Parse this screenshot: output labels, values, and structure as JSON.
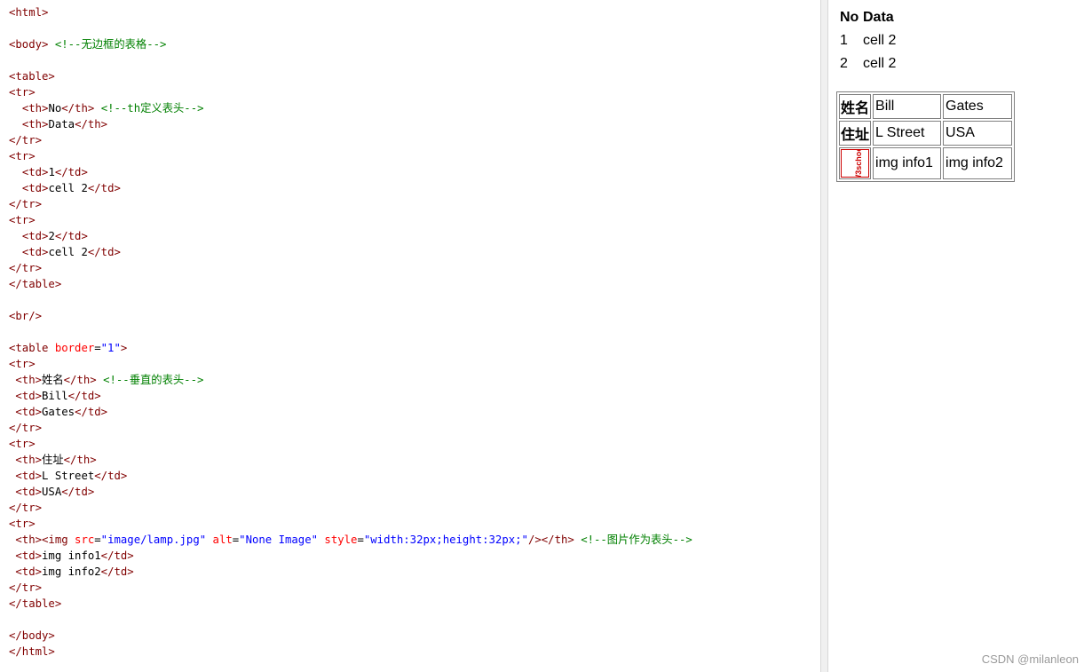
{
  "code_lines": [
    [
      {
        "c": "tag",
        "t": "<html>"
      }
    ],
    [],
    [
      {
        "c": "tag",
        "t": "<body>"
      },
      {
        "c": "txt",
        "t": " "
      },
      {
        "c": "cmt",
        "t": "<!--无边框的表格-->"
      }
    ],
    [],
    [
      {
        "c": "tag",
        "t": "<table>"
      }
    ],
    [
      {
        "c": "tag",
        "t": "<tr>"
      }
    ],
    [
      {
        "c": "txt",
        "t": "  "
      },
      {
        "c": "tag",
        "t": "<th>"
      },
      {
        "c": "txt",
        "t": "No"
      },
      {
        "c": "tag",
        "t": "</th>"
      },
      {
        "c": "txt",
        "t": " "
      },
      {
        "c": "cmt",
        "t": "<!--th定义表头-->"
      }
    ],
    [
      {
        "c": "txt",
        "t": "  "
      },
      {
        "c": "tag",
        "t": "<th>"
      },
      {
        "c": "txt",
        "t": "Data"
      },
      {
        "c": "tag",
        "t": "</th>"
      }
    ],
    [
      {
        "c": "tag",
        "t": "</tr>"
      }
    ],
    [
      {
        "c": "tag",
        "t": "<tr>"
      }
    ],
    [
      {
        "c": "txt",
        "t": "  "
      },
      {
        "c": "tag",
        "t": "<td>"
      },
      {
        "c": "txt",
        "t": "1"
      },
      {
        "c": "tag",
        "t": "</td>"
      }
    ],
    [
      {
        "c": "txt",
        "t": "  "
      },
      {
        "c": "tag",
        "t": "<td>"
      },
      {
        "c": "txt",
        "t": "cell 2"
      },
      {
        "c": "tag",
        "t": "</td>"
      }
    ],
    [
      {
        "c": "tag",
        "t": "</tr>"
      }
    ],
    [
      {
        "c": "tag",
        "t": "<tr>"
      }
    ],
    [
      {
        "c": "txt",
        "t": "  "
      },
      {
        "c": "tag",
        "t": "<td>"
      },
      {
        "c": "txt",
        "t": "2"
      },
      {
        "c": "tag",
        "t": "</td>"
      }
    ],
    [
      {
        "c": "txt",
        "t": "  "
      },
      {
        "c": "tag",
        "t": "<td>"
      },
      {
        "c": "txt",
        "t": "cell 2"
      },
      {
        "c": "tag",
        "t": "</td>"
      }
    ],
    [
      {
        "c": "tag",
        "t": "</tr>"
      }
    ],
    [
      {
        "c": "tag",
        "t": "</table>"
      }
    ],
    [],
    [
      {
        "c": "tag",
        "t": "<br/>"
      }
    ],
    [],
    [
      {
        "c": "tag",
        "t": "<table "
      },
      {
        "c": "attr",
        "t": "border"
      },
      {
        "c": "txt",
        "t": "="
      },
      {
        "c": "val",
        "t": "\"1\""
      },
      {
        "c": "tag",
        "t": ">"
      }
    ],
    [
      {
        "c": "tag",
        "t": "<tr>"
      }
    ],
    [
      {
        "c": "txt",
        "t": " "
      },
      {
        "c": "tag",
        "t": "<th>"
      },
      {
        "c": "txt",
        "t": "姓名"
      },
      {
        "c": "tag",
        "t": "</th>"
      },
      {
        "c": "txt",
        "t": " "
      },
      {
        "c": "cmt",
        "t": "<!--垂直的表头-->"
      }
    ],
    [
      {
        "c": "txt",
        "t": " "
      },
      {
        "c": "tag",
        "t": "<td>"
      },
      {
        "c": "txt",
        "t": "Bill"
      },
      {
        "c": "tag",
        "t": "</td>"
      }
    ],
    [
      {
        "c": "txt",
        "t": " "
      },
      {
        "c": "tag",
        "t": "<td>"
      },
      {
        "c": "txt",
        "t": "Gates"
      },
      {
        "c": "tag",
        "t": "</td>"
      }
    ],
    [
      {
        "c": "tag",
        "t": "</tr>"
      }
    ],
    [
      {
        "c": "tag",
        "t": "<tr>"
      }
    ],
    [
      {
        "c": "txt",
        "t": " "
      },
      {
        "c": "tag",
        "t": "<th>"
      },
      {
        "c": "txt",
        "t": "住址"
      },
      {
        "c": "tag",
        "t": "</th>"
      }
    ],
    [
      {
        "c": "txt",
        "t": " "
      },
      {
        "c": "tag",
        "t": "<td>"
      },
      {
        "c": "txt",
        "t": "L Street"
      },
      {
        "c": "tag",
        "t": "</td>"
      }
    ],
    [
      {
        "c": "txt",
        "t": " "
      },
      {
        "c": "tag",
        "t": "<td>"
      },
      {
        "c": "txt",
        "t": "USA"
      },
      {
        "c": "tag",
        "t": "</td>"
      }
    ],
    [
      {
        "c": "tag",
        "t": "</tr>"
      }
    ],
    [
      {
        "c": "tag",
        "t": "<tr>"
      }
    ],
    [
      {
        "c": "txt",
        "t": " "
      },
      {
        "c": "tag",
        "t": "<th><img "
      },
      {
        "c": "attr",
        "t": "src"
      },
      {
        "c": "txt",
        "t": "="
      },
      {
        "c": "val",
        "t": "\"image/lamp.jpg\""
      },
      {
        "c": "txt",
        "t": " "
      },
      {
        "c": "attr",
        "t": "alt"
      },
      {
        "c": "txt",
        "t": "="
      },
      {
        "c": "val",
        "t": "\"None Image\""
      },
      {
        "c": "txt",
        "t": " "
      },
      {
        "c": "attr",
        "t": "style"
      },
      {
        "c": "txt",
        "t": "="
      },
      {
        "c": "val",
        "t": "\"width:32px;height:32px;\""
      },
      {
        "c": "tag",
        "t": "/></th>"
      },
      {
        "c": "txt",
        "t": " "
      },
      {
        "c": "cmt",
        "t": "<!--图片作为表头-->"
      }
    ],
    [
      {
        "c": "txt",
        "t": " "
      },
      {
        "c": "tag",
        "t": "<td>"
      },
      {
        "c": "txt",
        "t": "img info1"
      },
      {
        "c": "tag",
        "t": "</td>"
      }
    ],
    [
      {
        "c": "txt",
        "t": " "
      },
      {
        "c": "tag",
        "t": "<td>"
      },
      {
        "c": "txt",
        "t": "img info2"
      },
      {
        "c": "tag",
        "t": "</td>"
      }
    ],
    [
      {
        "c": "tag",
        "t": "</tr>"
      }
    ],
    [
      {
        "c": "tag",
        "t": "</table>"
      }
    ],
    [],
    [
      {
        "c": "tag",
        "t": "</body>"
      }
    ],
    [
      {
        "c": "tag",
        "t": "</html>"
      }
    ]
  ],
  "preview": {
    "table1": {
      "headers": [
        "No",
        "Data"
      ],
      "rows": [
        [
          "1",
          "cell 2"
        ],
        [
          "2",
          "cell 2"
        ]
      ]
    },
    "table2": {
      "row1": {
        "th": "姓名",
        "td1": "Bill",
        "td2": "Gates"
      },
      "row2": {
        "th": "住址",
        "td1": "L Street",
        "td2": "USA"
      },
      "row3": {
        "logo_text": "W3school",
        "td1": "img info1",
        "td2": "img info2"
      }
    }
  },
  "watermark": "CSDN @milanleon",
  "colors": {
    "tag": "#800000",
    "attr": "#ff0000",
    "value": "#0000ff",
    "comment": "#008000",
    "logo": "#cc0000"
  }
}
